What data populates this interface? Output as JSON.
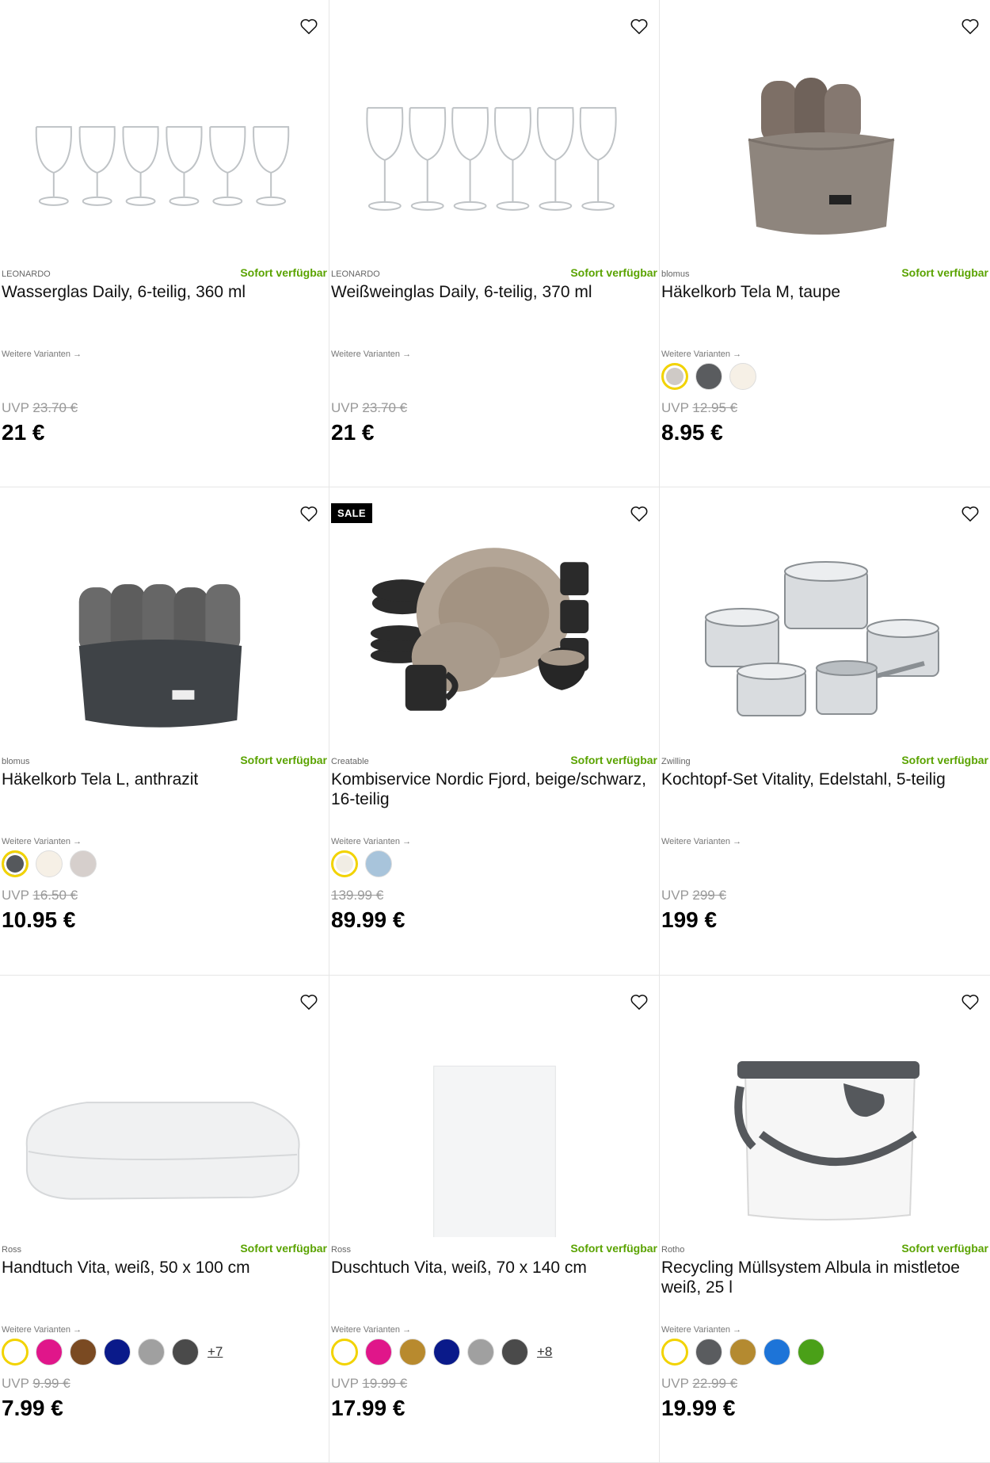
{
  "products": [
    {
      "brand": "LEONARDO",
      "stock": "Sofort verfügbar",
      "title": "Wasserglas Daily, 6-teilig, 360 ml",
      "variants_label": "Weitere Varianten →",
      "uvp_label": "UVP",
      "uvp_price": "23.70 €",
      "price": "21 €",
      "swatches": [],
      "more": ""
    },
    {
      "brand": "LEONARDO",
      "stock": "Sofort verfügbar",
      "title": "Weißweinglas Daily, 6-teilig, 370 ml",
      "variants_label": "Weitere Varianten →",
      "uvp_label": "UVP",
      "uvp_price": "23.70 €",
      "price": "21 €",
      "swatches": [],
      "more": ""
    },
    {
      "brand": "blomus",
      "stock": "Sofort verfügbar",
      "title": "Häkelkorb Tela M, taupe",
      "variants_label": "Weitere Varianten →",
      "uvp_label": "UVP",
      "uvp_price": "12.95 €",
      "price": "8.95 €",
      "swatches": [
        "#cfcac6",
        "#5a5c5f",
        "#f6f0e6"
      ],
      "more": ""
    },
    {
      "brand": "blomus",
      "stock": "Sofort verfügbar",
      "title": "Häkelkorb Tela L, anthrazit",
      "variants_label": "Weitere Varianten →",
      "uvp_label": "UVP",
      "uvp_price": "16.50 €",
      "price": "10.95 €",
      "swatches": [
        "#55585c",
        "#f6f0e6",
        "#d6cfcc"
      ],
      "more": ""
    },
    {
      "brand": "Creatable",
      "stock": "Sofort verfügbar",
      "title": "Kombiservice Nordic Fjord, beige/schwarz, 16-teilig",
      "variants_label": "Weitere Varianten →",
      "uvp_label": "",
      "uvp_price": "139.99 €",
      "price": "89.99 €",
      "swatches": [
        "#f1ede4",
        "#a8c4db"
      ],
      "more": "",
      "sale": "SALE"
    },
    {
      "brand": "Zwilling",
      "stock": "Sofort verfügbar",
      "title": "Kochtopf-Set Vitality, Edelstahl, 5-teilig",
      "variants_label": "Weitere Varianten →",
      "uvp_label": "UVP",
      "uvp_price": "299 €",
      "price": "199 €",
      "swatches": [],
      "more": ""
    },
    {
      "brand": "Ross",
      "stock": "Sofort verfügbar",
      "title": "Handtuch Vita, weiß, 50 x 100 cm",
      "variants_label": "Weitere Varianten →",
      "uvp_label": "UVP",
      "uvp_price": "9.99 €",
      "price": "7.99 €",
      "swatches": [
        "#ffffff",
        "#e0168a",
        "#7a4a22",
        "#0a1a8a",
        "#a0a0a0",
        "#4a4a4a"
      ],
      "more": "+7"
    },
    {
      "brand": "Ross",
      "stock": "Sofort verfügbar",
      "title": "Duschtuch Vita, weiß, 70 x 140 cm",
      "variants_label": "Weitere Varianten →",
      "uvp_label": "UVP",
      "uvp_price": "19.99 €",
      "price": "17.99 €",
      "swatches": [
        "#ffffff",
        "#e0168a",
        "#b88a2e",
        "#0a1a8a",
        "#a0a0a0",
        "#4a4a4a"
      ],
      "more": "+8"
    },
    {
      "brand": "Rotho",
      "stock": "Sofort verfügbar",
      "title": "Recycling Müllsystem Albula in mistletoe weiß, 25 l",
      "variants_label": "Weitere Varianten →",
      "uvp_label": "UVP",
      "uvp_price": "22.99 €",
      "price": "19.99 €",
      "swatches": [
        "#ffffff",
        "#5a5c5f",
        "#b48a30",
        "#1d74d8",
        "#4aa018"
      ],
      "more": ""
    }
  ],
  "icons": {
    "favorite": "heart-outline-icon"
  },
  "colors": {
    "stock_green": "#5aa300",
    "selected_ring": "#f2d300"
  }
}
